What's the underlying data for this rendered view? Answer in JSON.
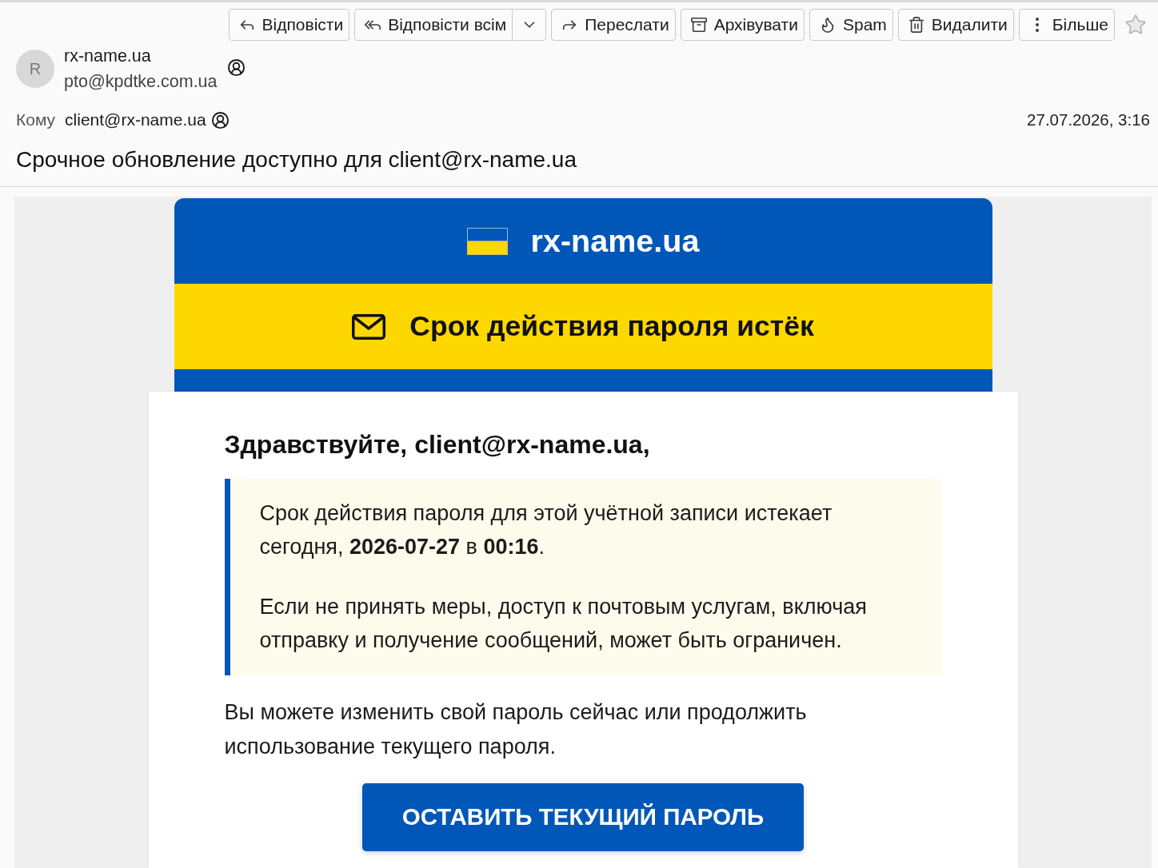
{
  "toolbar": {
    "buttons": [
      {
        "kind": "reply",
        "label": "Відповісти",
        "menu": false
      },
      {
        "kind": "reply_all",
        "label": "Відповісти всім",
        "menu": true
      },
      {
        "kind": "forward",
        "label": "Переслати",
        "menu": false
      },
      {
        "kind": "archive",
        "label": "Архівувати",
        "menu": false
      },
      {
        "kind": "spam",
        "label": "Spam",
        "menu": false
      },
      {
        "kind": "delete",
        "label": "Видалити",
        "menu": false
      },
      {
        "kind": "more",
        "label": "Більше",
        "menu": false
      }
    ],
    "starred": false
  },
  "sender": {
    "avatar_initial": "R",
    "name": "rx-name.ua",
    "email": "pto@kpdtke.com.ua"
  },
  "recipient": {
    "label": "Кому",
    "email": "client@rx-name.ua"
  },
  "date": "27.07.2026, 3:16",
  "subject": "Срочное обновление доступно для client@rx-name.ua",
  "email_body": {
    "brand": "rx-name.ua",
    "banner_title": "Срок действия пароля истёк",
    "greeting": "Здравствуйте, client@rx-name.ua,",
    "notice": [
      "Срок действия пароля для этой учётной записи истекает сегодня, **2026-07-27** в **00:16**.",
      "Если не принять меры, доступ к почтовым услугам, включая отправку и получение сообщений, может быть ограничен."
    ],
    "paragraph": "Вы можете изменить свой пароль сейчас или продолжить использование текущего пароля.",
    "button": "ОСТАВИТЬ ТЕКУЩИЙ ПАРОЛЬ"
  }
}
